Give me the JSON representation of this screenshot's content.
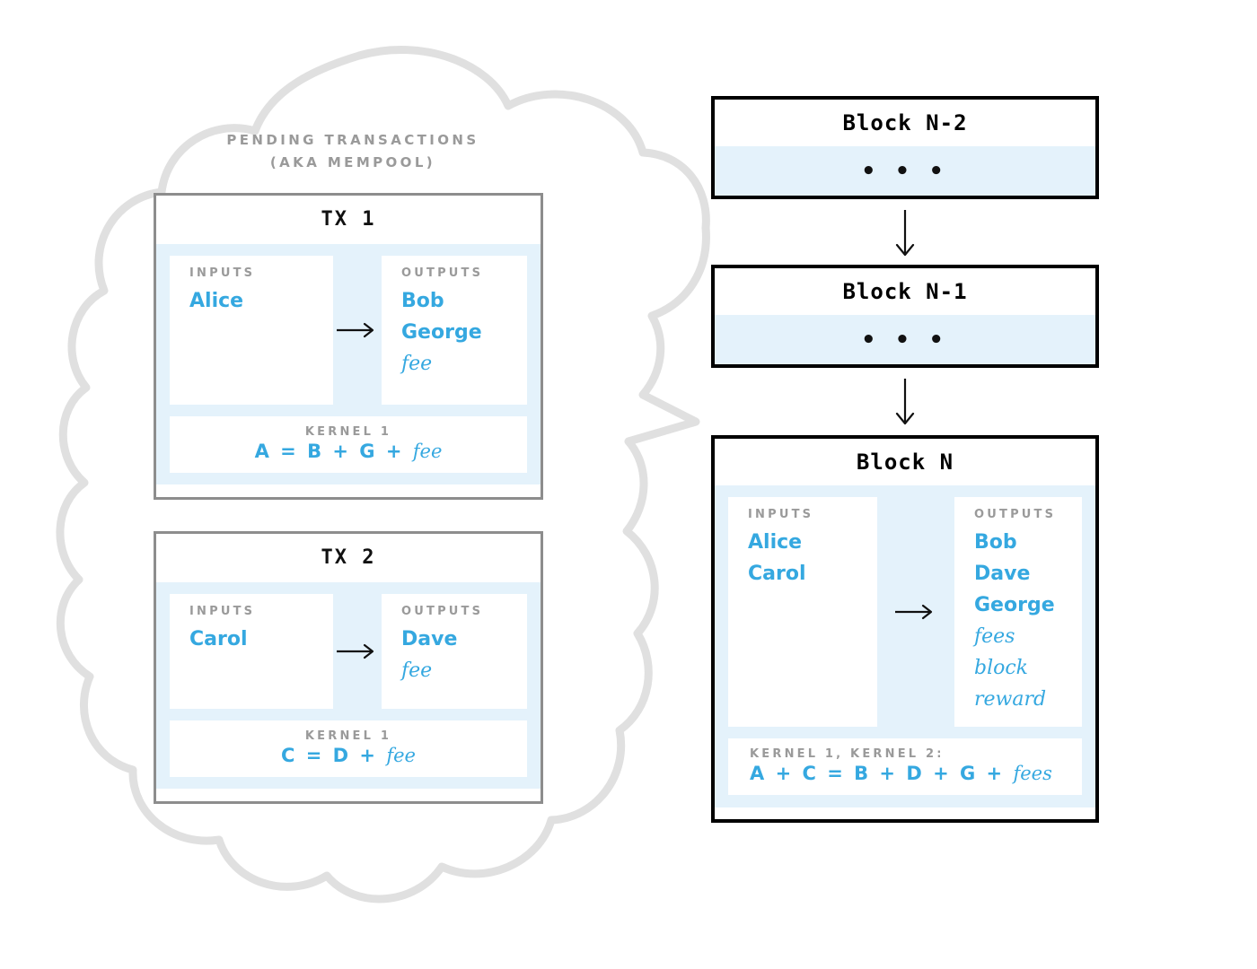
{
  "colors": {
    "accent_blue": "#35a8e0",
    "light_blue_bg": "#e4f2fb",
    "gray_label": "#9a9a9a",
    "cloud_stroke": "#e0e0e0",
    "tx_border": "#8d8d8d",
    "block_border": "#000000"
  },
  "mempool": {
    "title_line1": "PENDING TRANSACTIONS",
    "title_line2": "(AKA MEMPOOL)",
    "transactions": [
      {
        "title": "TX 1",
        "inputs_label": "INPUTS",
        "outputs_label": "OUTPUTS",
        "inputs": [
          "Alice"
        ],
        "outputs": [
          "Bob",
          "George"
        ],
        "outputs_italic": [
          "fee"
        ],
        "kernel_label": "KERNEL 1",
        "kernel_equation_plain": "A = B + G + ",
        "kernel_equation_italic": "fee"
      },
      {
        "title": "TX 2",
        "inputs_label": "INPUTS",
        "outputs_label": "OUTPUTS",
        "inputs": [
          "Carol"
        ],
        "outputs": [
          "Dave"
        ],
        "outputs_italic": [
          "fee"
        ],
        "kernel_label": "KERNEL 1",
        "kernel_equation_plain": "C = D + ",
        "kernel_equation_italic": "fee"
      }
    ]
  },
  "chain": {
    "blocks": [
      {
        "title": "Block N-2",
        "content": "• • •"
      },
      {
        "title": "Block N-1",
        "content": "• • •"
      }
    ],
    "arrow_icon": "down-arrow-icon",
    "block_n": {
      "title": "Block N",
      "inputs_label": "INPUTS",
      "outputs_label": "OUTPUTS",
      "inputs": [
        "Alice",
        "Carol"
      ],
      "outputs": [
        "Bob",
        "Dave",
        "George"
      ],
      "outputs_italic": [
        "fees",
        "block",
        "reward"
      ],
      "kernel_label": "KERNEL 1, KERNEL 2:",
      "kernel_equation_plain": "A + C = B + D + G + ",
      "kernel_equation_italic": "fees"
    }
  }
}
